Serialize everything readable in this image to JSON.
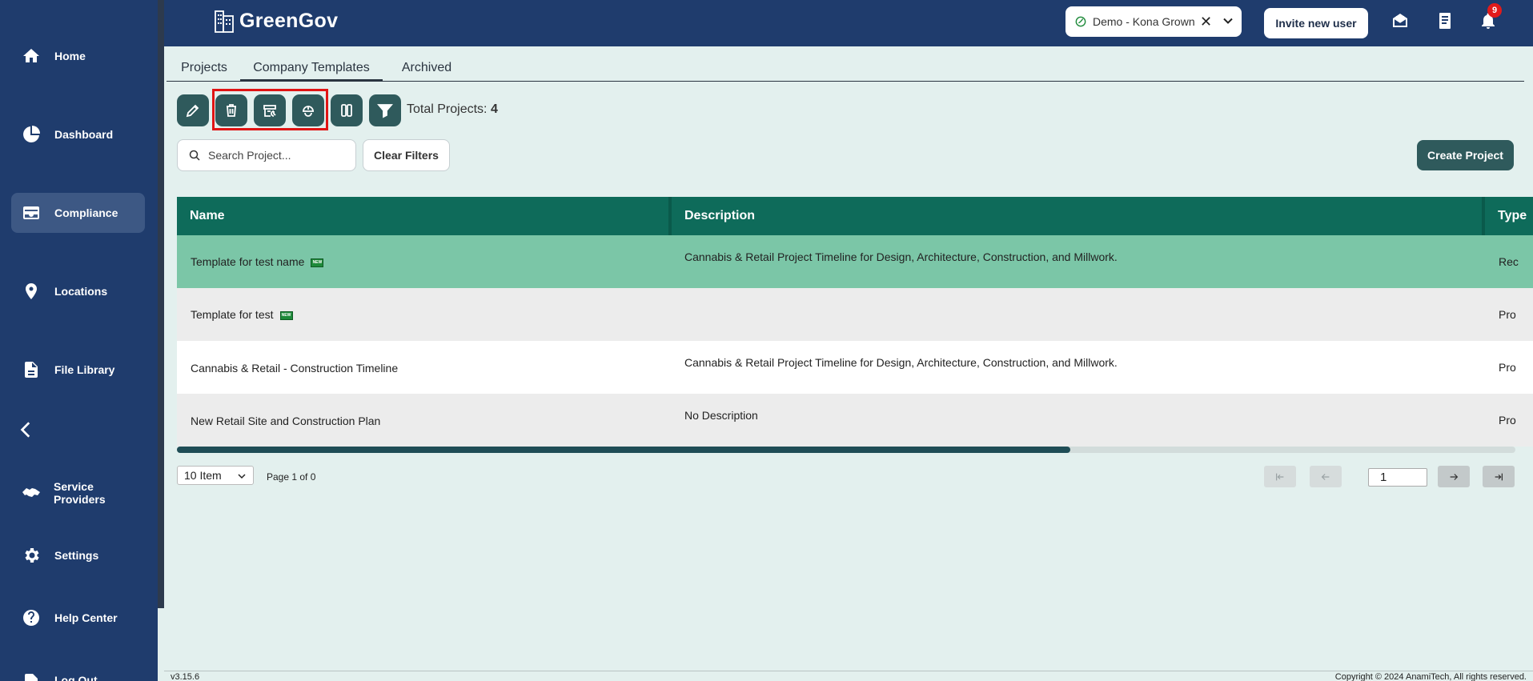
{
  "app": {
    "name": "GreenGov"
  },
  "sidebar": {
    "items": [
      {
        "label": "Home",
        "icon": "home-icon"
      },
      {
        "label": "Dashboard",
        "icon": "pie-chart-icon"
      },
      {
        "label": "Compliance",
        "icon": "inbox-icon"
      },
      {
        "label": "Locations",
        "icon": "location-pin-icon"
      },
      {
        "label": "File Library",
        "icon": "file-icon"
      },
      {
        "label": "Service Providers",
        "icon": "handshake-icon"
      },
      {
        "label": "Settings",
        "icon": "gear-icon"
      },
      {
        "label": "Help Center",
        "icon": "help-icon"
      },
      {
        "label": "Log Out",
        "icon": "logout-icon"
      }
    ],
    "active": "Compliance"
  },
  "header": {
    "tenant": "Demo - Kona Grown",
    "invite_label": "Invite new user",
    "notification_count": "9"
  },
  "tabs": [
    {
      "label": "Projects"
    },
    {
      "label": "Company Templates"
    },
    {
      "label": "Archived"
    }
  ],
  "active_tab": "Company Templates",
  "toolbar": {
    "total_label": "Total Projects:",
    "total_count": "4",
    "highlight_color": "#e01414"
  },
  "filters": {
    "search_placeholder": "Search Project...",
    "clear_label": "Clear Filters",
    "create_label": "Create Project"
  },
  "table": {
    "columns": [
      "Name",
      "Description",
      "Type"
    ],
    "rows": [
      {
        "name": "Template for test name",
        "is_new": true,
        "description": "Cannabis & Retail Project Timeline for Design, Architecture, Construction, and Millwork.",
        "type": "Rec"
      },
      {
        "name": "Template for test",
        "is_new": true,
        "description": "",
        "type": "Pro"
      },
      {
        "name": "Cannabis & Retail - Construction Timeline",
        "is_new": false,
        "description": "Cannabis & Retail Project Timeline for Design, Architecture, Construction, and Millwork.",
        "type": "Pro"
      },
      {
        "name": "New Retail Site and Construction Plan",
        "is_new": false,
        "description": "No Description",
        "type": "Pro"
      }
    ],
    "new_tag": "NEW"
  },
  "pagination": {
    "page_size": "10 Item",
    "page_info": "Page 1 of 0",
    "current_page": "1"
  },
  "footer": {
    "version": "v3.15.6",
    "copyright": "Copyright © 2024 AnamiTech, All rights reserved."
  },
  "colors": {
    "sidebar_bg": "#1f3c6d",
    "primary_button": "#2f5a5c",
    "table_header": "#0e6b5a",
    "selected_row": "#7bc6a7"
  }
}
